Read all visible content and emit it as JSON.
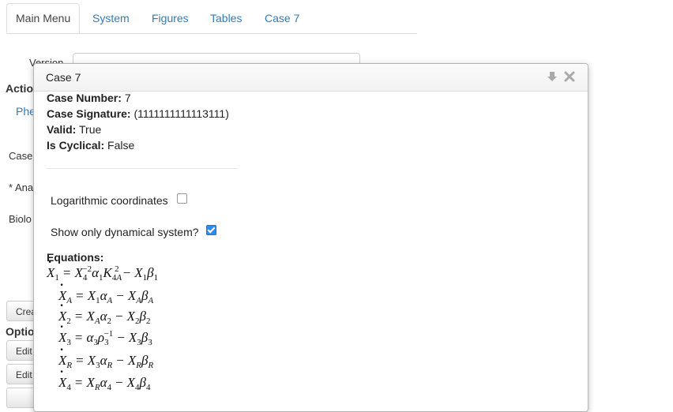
{
  "tabs": [
    "Main Menu",
    "System",
    "Figures",
    "Tables",
    "Case 7"
  ],
  "background": {
    "version_label": "Version",
    "actions_label": "Actio",
    "phe_link": "Phe",
    "case_label": "Case",
    "ana_label": "* Ana",
    "bio_label": "Biolo",
    "create_btn": "Crea",
    "options_label": "Optio",
    "edit_btn_1": "Edit",
    "edit_btn_2": "Edit"
  },
  "dialog": {
    "title": "Case 7",
    "case_number_label": "Case Number:",
    "case_number": "7",
    "case_signature_label": "Case Signature:",
    "case_signature": "(1111111111113111)",
    "valid_label": "Valid:",
    "valid": "True",
    "cyclical_label": "Is Cyclical:",
    "cyclical": "False",
    "log_coords_label": "Logarithmic coordinates",
    "log_coords_checked": false,
    "dyn_only_label": "Show only dynamical system?",
    "dyn_only_checked": true,
    "equations_label": "Equations:"
  },
  "icons": {
    "collapse": "arrow-down-icon",
    "close": "close-icon"
  },
  "colors": {
    "accent": "#337ab7",
    "checkbox": "#2d8cf0"
  }
}
